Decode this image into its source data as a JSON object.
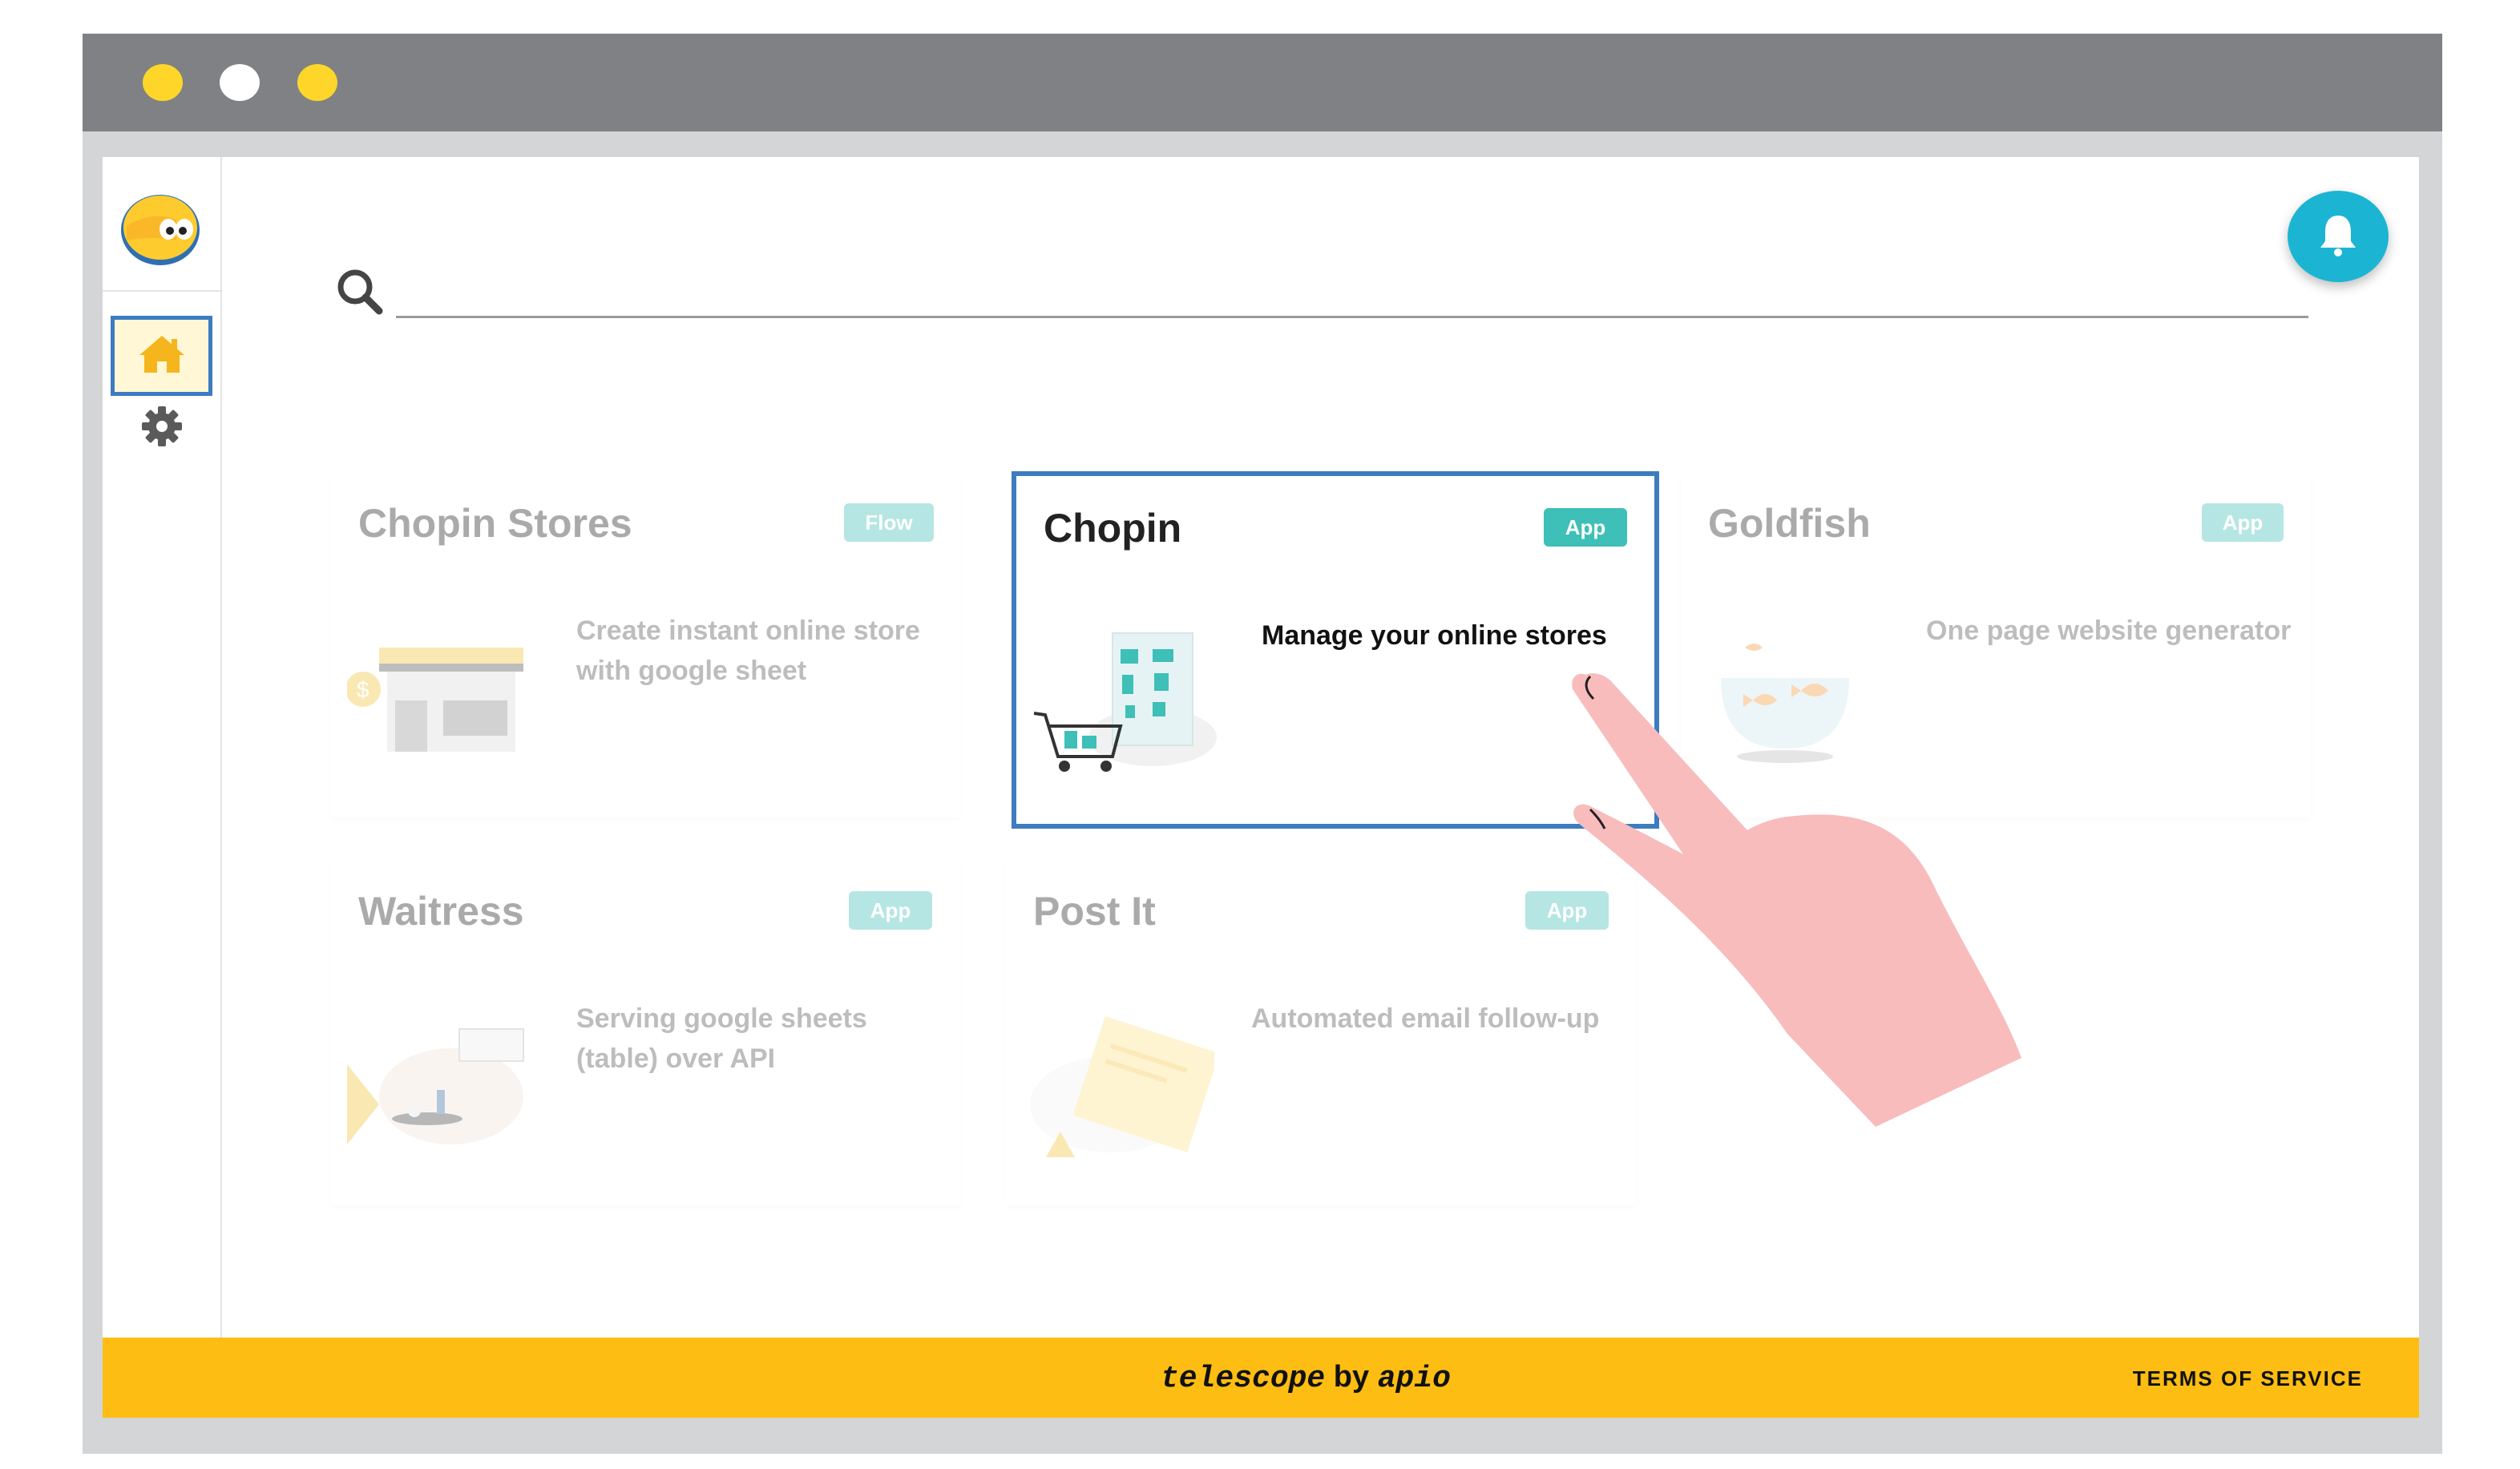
{
  "window": {
    "dots": [
      "#fed62a",
      "#ffffff",
      "#fed62a"
    ]
  },
  "sidebar": {
    "logo_icon": "owl-logo",
    "items": [
      {
        "name": "home",
        "icon": "home-icon",
        "active": true
      },
      {
        "name": "settings",
        "icon": "gear-icon",
        "active": false
      }
    ]
  },
  "search": {
    "placeholder": "",
    "value": "",
    "icon": "search-icon"
  },
  "notifications": {
    "icon": "bell-icon"
  },
  "cards": [
    {
      "title": "Chopin Stores",
      "badge": "Flow",
      "description": "Create instant online store with google sheet",
      "illustration": "store-illustration",
      "selected": false
    },
    {
      "title": "Chopin",
      "badge": "App",
      "description": "Manage your online stores",
      "illustration": "shopping-cart-illustration",
      "selected": true
    },
    {
      "title": "Goldfish",
      "badge": "App",
      "description": "One page website generator",
      "illustration": "fishbowl-illustration",
      "selected": false
    },
    {
      "title": "Waitress",
      "badge": "App",
      "description": "Serving google sheets (table) over API",
      "illustration": "waitress-illustration",
      "selected": false
    },
    {
      "title": "Post It",
      "badge": "App",
      "description": "Automated email follow-up",
      "illustration": "post-it-illustration",
      "selected": false
    }
  ],
  "footer": {
    "brand_name": "telescope",
    "brand_by": "by",
    "brand_company": "apio",
    "terms": "TERMS OF SERVICE"
  },
  "colors": {
    "accent": "#fdbd12",
    "selection": "#3d7cc0",
    "badge": "#3ebfb7",
    "bell": "#1bb5d3",
    "hand": "#f8bcbd"
  }
}
